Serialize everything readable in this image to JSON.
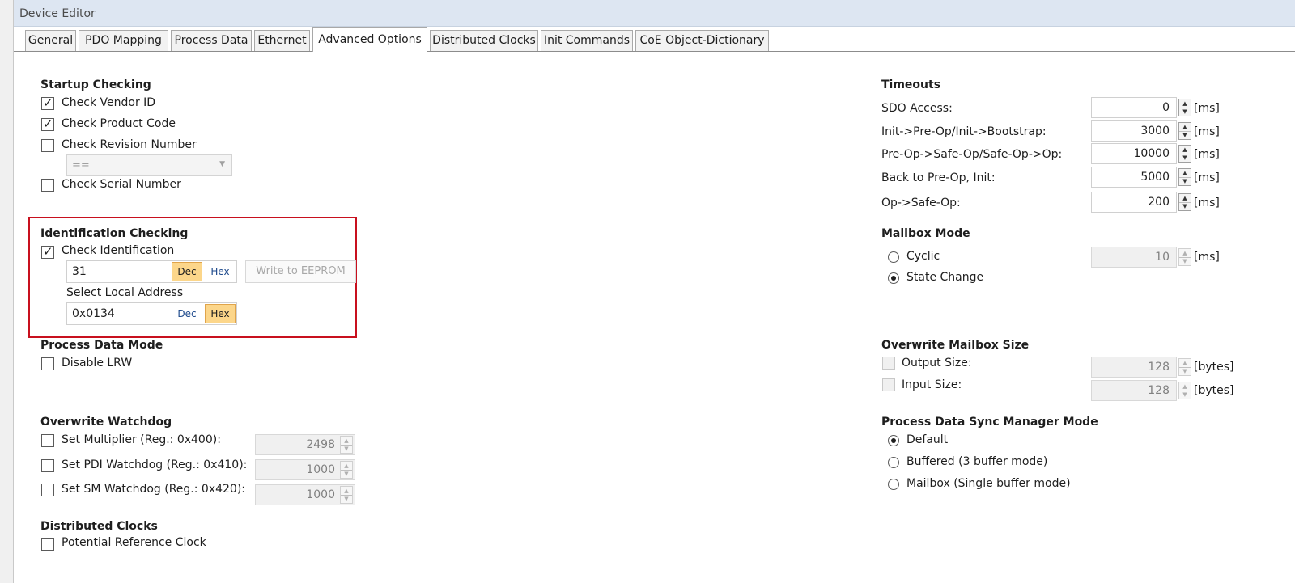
{
  "window": {
    "title": "Device Editor"
  },
  "tabs": [
    "General",
    "PDO Mapping",
    "Process Data",
    "Ethernet",
    "Advanced Options",
    "Distributed Clocks",
    "Init Commands",
    "CoE Object-Dictionary"
  ],
  "active_tab": "Advanced Options",
  "startup": {
    "header": "Startup Checking",
    "vendor": {
      "label": "Check Vendor ID",
      "checked": true
    },
    "product": {
      "label": "Check Product Code",
      "checked": true
    },
    "revision": {
      "label": "Check Revision Number",
      "checked": false
    },
    "compare_select": "==",
    "serial": {
      "label": "Check Serial Number",
      "checked": false
    }
  },
  "identification": {
    "header": "Identification Checking",
    "check": {
      "label": "Check Identification",
      "checked": true
    },
    "value": "31",
    "dec_label": "Dec",
    "hex_label": "Hex",
    "write_button": "Write to EEPROM",
    "select_local_label": "Select Local Address",
    "local_value": "0x0134"
  },
  "process_data_mode": {
    "header": "Process Data Mode",
    "disable_lrw": {
      "label": "Disable LRW",
      "checked": false
    }
  },
  "watchdog": {
    "header": "Overwrite Watchdog",
    "multiplier": {
      "label": "Set Multiplier (Reg.: 0x400):",
      "value": "2498",
      "checked": false
    },
    "pdi": {
      "label": "Set PDI Watchdog (Reg.: 0x410):",
      "value": "1000",
      "checked": false
    },
    "sm": {
      "label": "Set SM Watchdog (Reg.: 0x420):",
      "value": "1000",
      "checked": false
    }
  },
  "distributed_clocks": {
    "header": "Distributed Clocks",
    "ref_clock": {
      "label": "Potential Reference Clock",
      "checked": false
    }
  },
  "timeouts": {
    "header": "Timeouts",
    "unit": "[ms]",
    "sdo": {
      "label": "SDO Access:",
      "value": "0"
    },
    "init_preop": {
      "label": "Init->Pre-Op/Init->Bootstrap:",
      "value": "3000"
    },
    "preop_safeop": {
      "label": "Pre-Op->Safe-Op/Safe-Op->Op:",
      "value": "10000"
    },
    "back_preop": {
      "label": "Back to Pre-Op, Init:",
      "value": "5000"
    },
    "op_safeop": {
      "label": "Op->Safe-Op:",
      "value": "200"
    }
  },
  "mailbox_mode": {
    "header": "Mailbox Mode",
    "cyclic": {
      "label": "Cyclic",
      "selected": false
    },
    "state_change": {
      "label": "State Change",
      "selected": true
    },
    "cycle_value": "10",
    "unit": "[ms]"
  },
  "mailbox_size": {
    "header": "Overwrite Mailbox Size",
    "unit": "[bytes]",
    "output": {
      "label": "Output Size:",
      "value": "128"
    },
    "input": {
      "label": "Input Size:",
      "value": "128"
    }
  },
  "sync_manager": {
    "header": "Process Data Sync Manager Mode",
    "default": {
      "label": "Default",
      "selected": true
    },
    "buffered": {
      "label": "Buffered (3 buffer mode)",
      "selected": false
    },
    "mailbox": {
      "label": "Mailbox (Single buffer mode)",
      "selected": false
    }
  }
}
